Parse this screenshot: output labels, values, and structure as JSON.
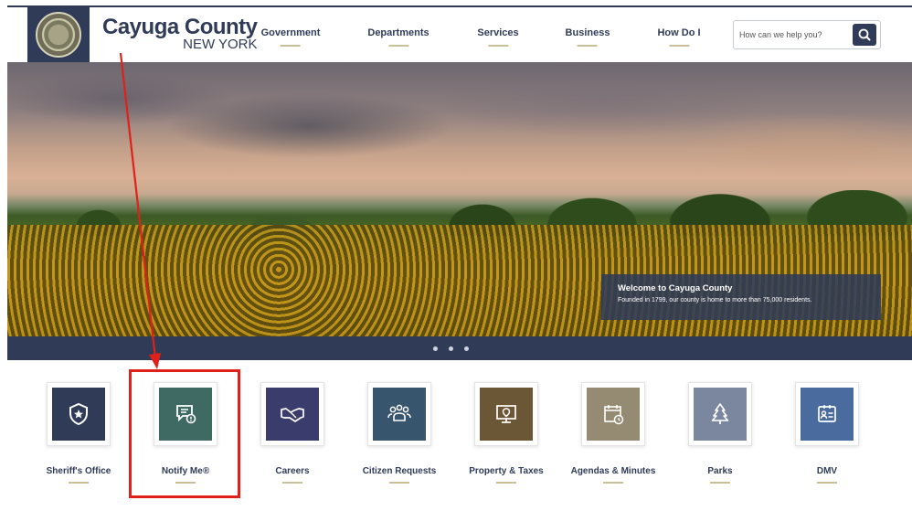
{
  "header": {
    "logo_line1": "Cayuga County",
    "logo_line2": "NEW YORK",
    "nav": [
      {
        "label": "Government"
      },
      {
        "label": "Departments"
      },
      {
        "label": "Services"
      },
      {
        "label": "Business"
      },
      {
        "label": "How Do I"
      }
    ],
    "search": {
      "placeholder": "How can we help you?"
    }
  },
  "hero": {
    "welcome_title": "Welcome to Cayuga County",
    "welcome_text": "Founded in 1799, our county is home to more than 75,000 residents.",
    "slide_count": 3
  },
  "quick_links": [
    {
      "label": "Sheriff's Office",
      "icon": "shield-star-icon",
      "color": "#2f3b57"
    },
    {
      "label": "Notify Me®",
      "icon": "chat-alert-icon",
      "color": "#3e6a63"
    },
    {
      "label": "Careers",
      "icon": "handshake-icon",
      "color": "#3a3d6b"
    },
    {
      "label": "Citizen Requests",
      "icon": "people-group-icon",
      "color": "#37556d"
    },
    {
      "label": "Property & Taxes",
      "icon": "map-pin-monitor-icon",
      "color": "#6b5736"
    },
    {
      "label": "Agendas & Minutes",
      "icon": "calendar-clock-icon",
      "color": "#958b73"
    },
    {
      "label": "Parks",
      "icon": "tree-icon",
      "color": "#7b879f"
    },
    {
      "label": "DMV",
      "icon": "id-card-icon",
      "color": "#4a6b9e"
    }
  ],
  "colors": {
    "brand": "#2f3b57",
    "accent_underline": "#c9c099",
    "annotation_red": "#e0201a"
  }
}
